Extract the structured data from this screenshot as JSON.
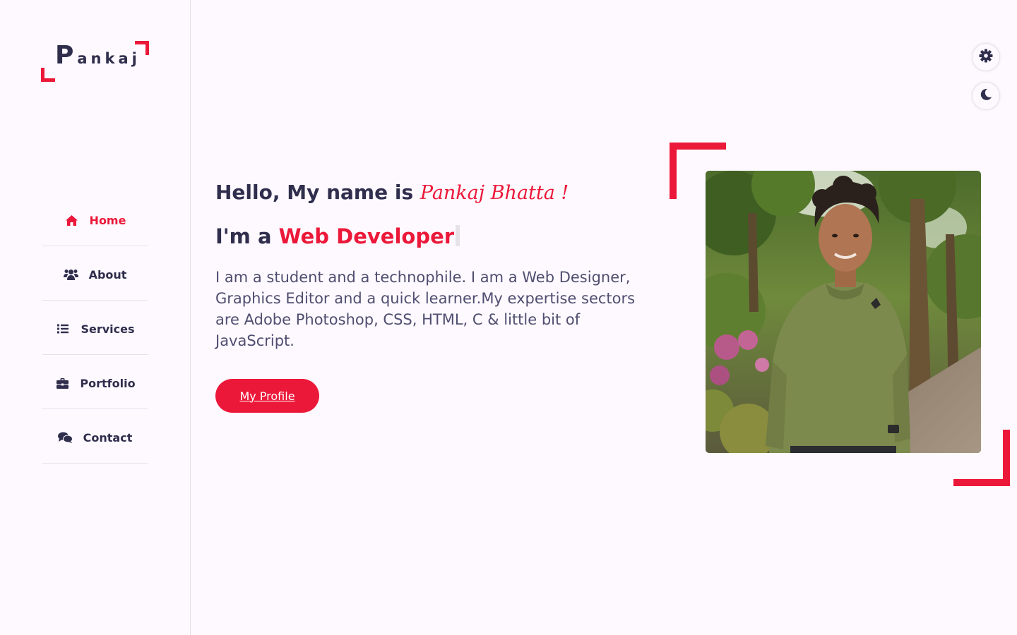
{
  "sidebar": {
    "logo_first": "P",
    "logo_rest": "ankaj",
    "nav": [
      {
        "label": "Home",
        "icon": "home-icon",
        "active": true
      },
      {
        "label": "About",
        "icon": "users-icon",
        "active": false
      },
      {
        "label": "Services",
        "icon": "list-icon",
        "active": false
      },
      {
        "label": "Portfolio",
        "icon": "briefcase-icon",
        "active": false
      },
      {
        "label": "Contact",
        "icon": "comments-icon",
        "active": false
      }
    ]
  },
  "home": {
    "greeting": "Hello, My name is",
    "name": "Pankaj Bhatta !",
    "role_prefix": "I'm a",
    "role_typed": "Web Developer",
    "intro": "I am a student and a technophile. I am a Web Designer, Graphics Editor and a quick learner.My expertise sectors are Adobe Photoshop, CSS, HTML, C & little bit of JavaScript.",
    "button_label": "My Profile"
  },
  "switchers": {
    "style_icon": "gear-icon",
    "theme_icon": "moon-icon"
  },
  "colors": {
    "accent": "#ec1839",
    "text_dark": "#302e4d",
    "text_body": "#504e70",
    "background": "#fdf9ff"
  }
}
